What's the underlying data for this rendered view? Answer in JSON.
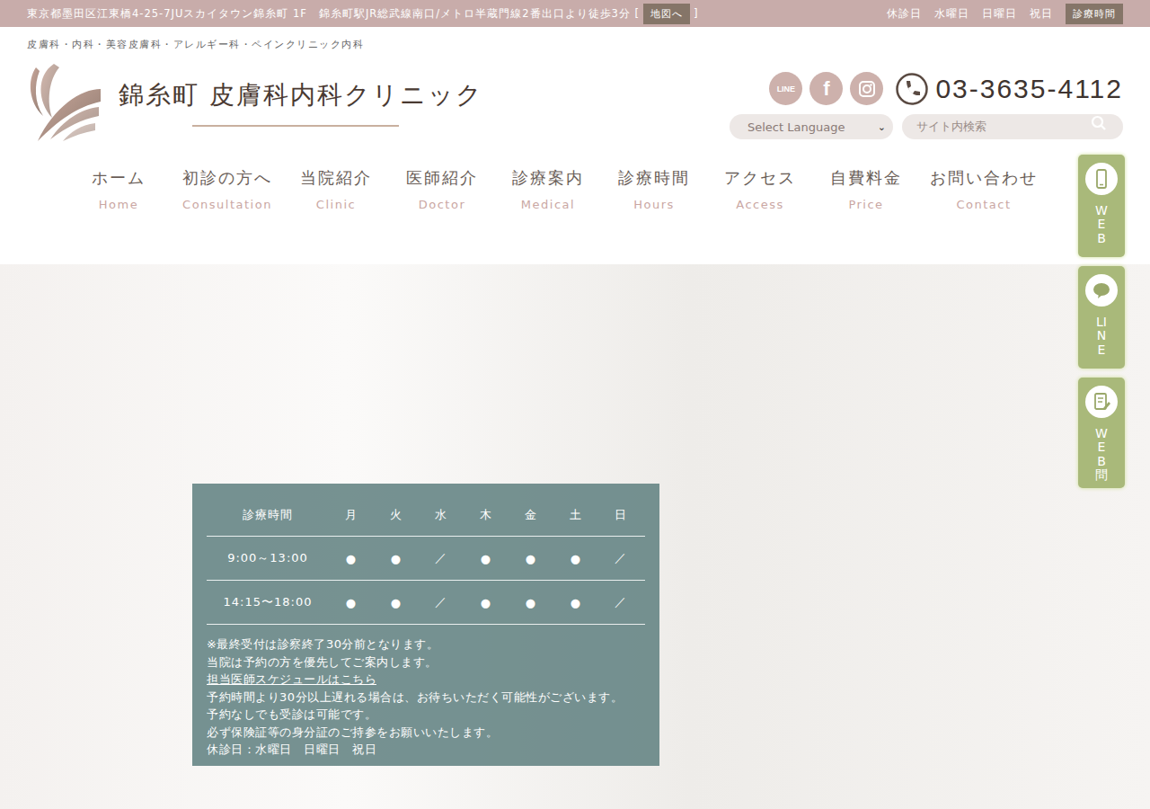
{
  "topbar": {
    "address": "東京都墨田区江東橋4-25-7JUスカイタウン錦糸町 1F　錦糸町駅JR総武線南口/メトロ半蔵門線2番出口より徒歩3分 [",
    "map_button": "地図へ",
    "address_end": "]",
    "closed_days": [
      "休診日",
      "水曜日",
      "日曜日",
      "祝日"
    ],
    "hours_button": "診療時間"
  },
  "header": {
    "tagline": "皮膚科・内科・美容皮膚科・アレルギー科・ペインクリニック内科",
    "logo_title": "錦糸町 皮膚科内科クリニック",
    "social": [
      {
        "name": "line",
        "glyph": "LINE"
      },
      {
        "name": "facebook",
        "glyph": "f"
      },
      {
        "name": "instagram",
        "glyph": ""
      }
    ],
    "phone": "03-3635-4112",
    "language": "Select Language",
    "search_placeholder": "サイト内検索"
  },
  "nav": [
    {
      "ja": "ホーム",
      "en": "Home"
    },
    {
      "ja": "初診の方へ",
      "en": "Consultation"
    },
    {
      "ja": "当院紹介",
      "en": "Clinic"
    },
    {
      "ja": "医師紹介",
      "en": "Doctor"
    },
    {
      "ja": "診療案内",
      "en": "Medical"
    },
    {
      "ja": "診療時間",
      "en": "Hours"
    },
    {
      "ja": "アクセス",
      "en": "Access"
    },
    {
      "ja": "自費料金",
      "en": "Price"
    },
    {
      "ja": "お問い合わせ",
      "en": "Contact"
    }
  ],
  "schedule": {
    "columns": [
      "診療時間",
      "月",
      "火",
      "水",
      "木",
      "金",
      "土",
      "日"
    ],
    "rows": [
      {
        "time": "9:00～13:00",
        "marks": [
          "●",
          "●",
          "／",
          "●",
          "●",
          "●",
          "／"
        ]
      },
      {
        "time": "14:15〜18:00",
        "marks": [
          "●",
          "●",
          "／",
          "●",
          "●",
          "●",
          "／"
        ]
      }
    ],
    "notes": [
      {
        "text": "※最終受付は診察終了30分前となります。",
        "link": false
      },
      {
        "text": "当院は予約の方を優先してご案内します。",
        "link": false
      },
      {
        "text": "担当医師スケジュールはこちら",
        "link": true
      },
      {
        "text": "予約時間より30分以上遅れる場合は、お待ちいただく可能性がございます。",
        "link": false
      },
      {
        "text": "予約なしでも受診は可能です。",
        "link": false
      },
      {
        "text": "必ず保険証等の身分証のご持参をお願いいたします。",
        "link": false
      },
      {
        "text": "休診日：水曜日　日曜日　祝日",
        "link": false
      }
    ]
  },
  "side_buttons": [
    {
      "kind": "phone",
      "label": "WEB"
    },
    {
      "kind": "line",
      "label": "LINE"
    },
    {
      "kind": "form",
      "label": "WEB問"
    }
  ]
}
